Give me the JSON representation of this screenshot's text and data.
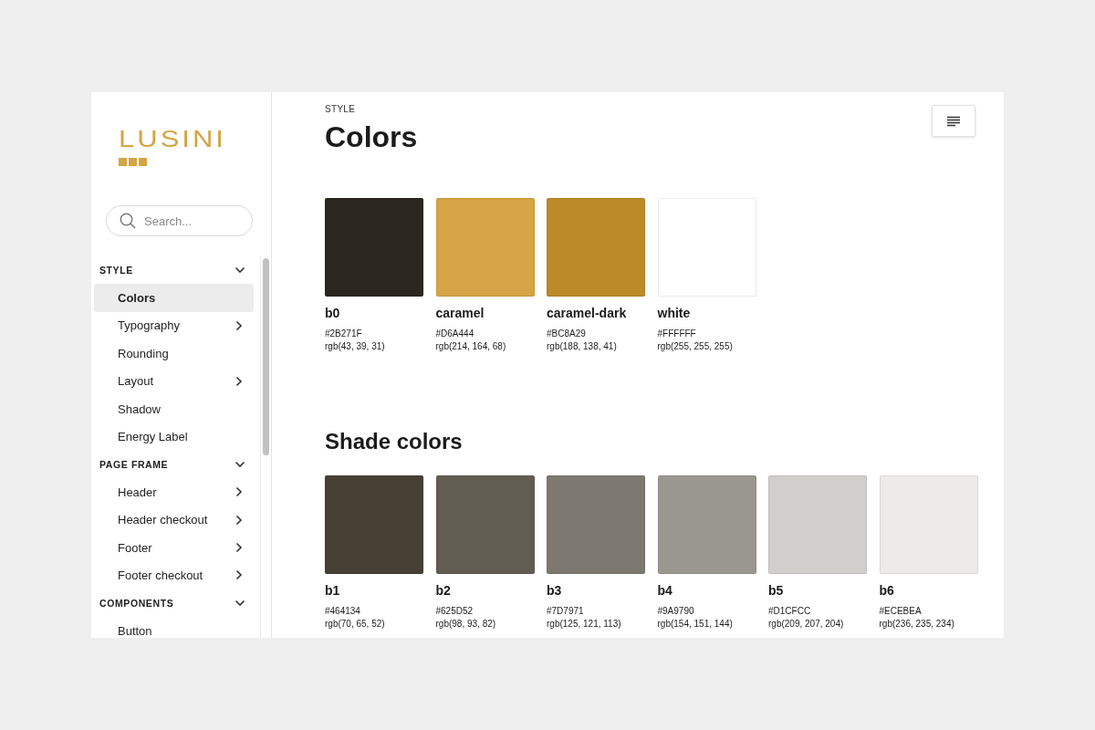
{
  "sidebar": {
    "logo": "LUSINI",
    "search": {
      "placeholder": "Search..."
    },
    "groups": [
      {
        "title": "STYLE",
        "expanded": true,
        "items": [
          {
            "label": "Colors",
            "selected": true,
            "expandable": false
          },
          {
            "label": "Typography",
            "selected": false,
            "expandable": true
          },
          {
            "label": "Rounding",
            "selected": false,
            "expandable": false
          },
          {
            "label": "Layout",
            "selected": false,
            "expandable": true
          },
          {
            "label": "Shadow",
            "selected": false,
            "expandable": false
          },
          {
            "label": "Energy Label",
            "selected": false,
            "expandable": false
          }
        ]
      },
      {
        "title": "PAGE FRAME",
        "expanded": true,
        "items": [
          {
            "label": "Header",
            "selected": false,
            "expandable": true
          },
          {
            "label": "Header checkout",
            "selected": false,
            "expandable": true
          },
          {
            "label": "Footer",
            "selected": false,
            "expandable": true
          },
          {
            "label": "Footer checkout",
            "selected": false,
            "expandable": true
          }
        ]
      },
      {
        "title": "COMPONENTS",
        "expanded": true,
        "items": [
          {
            "label": "Button",
            "selected": false,
            "expandable": false
          }
        ]
      }
    ]
  },
  "page": {
    "eyebrow": "STYLE",
    "title": "Colors",
    "sections": [
      {
        "swatches": [
          {
            "name": "b0",
            "color": "#2b271f",
            "hex": "#2B271F",
            "rgb": "rgb(43, 39, 31)"
          },
          {
            "name": "caramel",
            "color": "#d6a444",
            "hex": "#D6A444",
            "rgb": "rgb(214, 164, 68)"
          },
          {
            "name": "caramel-dark",
            "color": "#bc8a29",
            "hex": "#BC8A29",
            "rgb": "rgb(188, 138, 41)"
          },
          {
            "name": "white",
            "color": "#ffffff",
            "hex": "#FFFFFF",
            "rgb": "rgb(255, 255, 255)"
          }
        ]
      },
      {
        "heading": "Shade colors",
        "swatches": [
          {
            "name": "b1",
            "color": "#464134",
            "hex": "#464134",
            "rgb": "rgb(70, 65, 52)"
          },
          {
            "name": "b2",
            "color": "#625d52",
            "hex": "#625D52",
            "rgb": "rgb(98, 93, 82)"
          },
          {
            "name": "b3",
            "color": "#7d7971",
            "hex": "#7D7971",
            "rgb": "rgb(125, 121, 113)"
          },
          {
            "name": "b4",
            "color": "#9a9790",
            "hex": "#9A9790",
            "rgb": "rgb(154, 151, 144)"
          },
          {
            "name": "b5",
            "color": "#d1cfcc",
            "hex": "#D1CFCC",
            "rgb": "rgb(209, 207, 204)"
          },
          {
            "name": "b6",
            "color": "#ecebea",
            "hex": "#ECEBEA",
            "rgb": "rgb(236, 235, 234)"
          }
        ]
      }
    ]
  }
}
